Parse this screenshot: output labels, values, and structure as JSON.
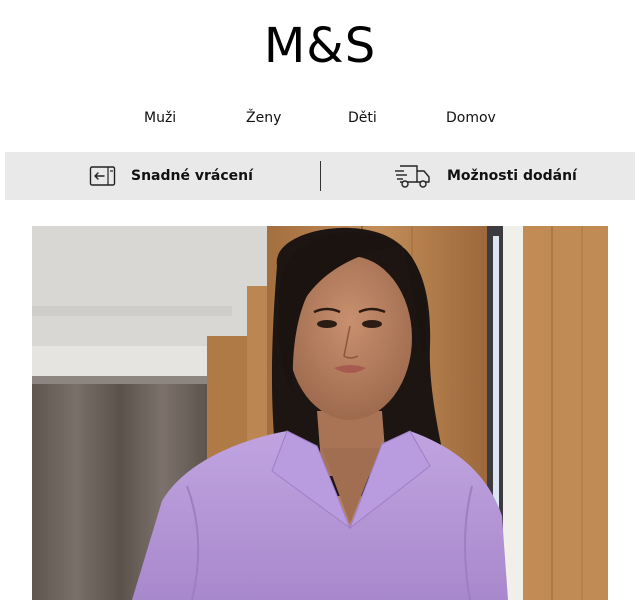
{
  "brand": {
    "logo_text": "M&S"
  },
  "nav": {
    "items": [
      {
        "label": "Muži"
      },
      {
        "label": "Ženy"
      },
      {
        "label": "Děti"
      },
      {
        "label": "Domov"
      }
    ]
  },
  "benefits": {
    "returns": {
      "label": "Snadné vrácení",
      "icon": "return-card-icon"
    },
    "delivery": {
      "label": "Možnosti dodání",
      "icon": "delivery-truck-icon"
    }
  },
  "hero": {
    "image": "woman-in-lilac-knit-polo-sweater",
    "colors": {
      "sweater": "#b395d6",
      "wood": "#b9844f",
      "wall": "#e4e2de"
    }
  }
}
